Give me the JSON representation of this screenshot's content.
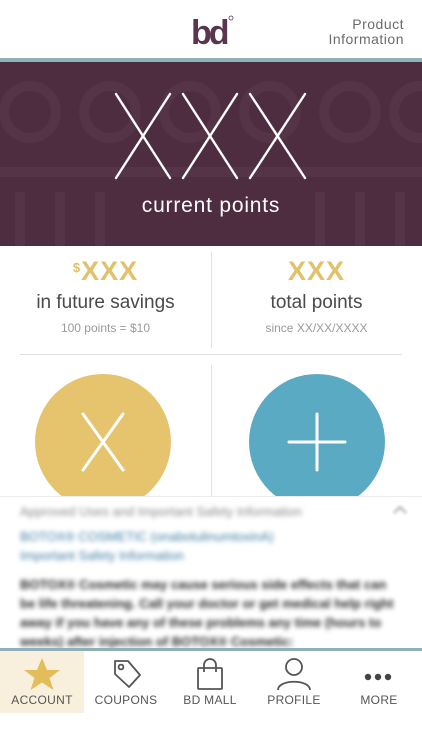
{
  "header": {
    "logo_text": "bd",
    "product_info_line1": "Product",
    "product_info_line2": "Information"
  },
  "hero": {
    "points_value": "XXX",
    "caption": "current points"
  },
  "stats": {
    "savings": {
      "currency": "$",
      "value": "XXX",
      "label": "in future savings",
      "sub": "100 points = $10"
    },
    "total": {
      "value": "XXX",
      "label": "total points",
      "sub": "since XX/XX/XXXX"
    }
  },
  "actions": {
    "remove": {
      "icon": "x-icon",
      "color": "#e6c46e"
    },
    "add": {
      "icon": "plus-icon",
      "color": "#5aaac4"
    }
  },
  "safety": {
    "heading": "Approved Uses and Important Safety Information",
    "link_line1": "BOTOX® COSMETIC (onabotulinumtoxinA)",
    "link_line2": "Important Safety Information",
    "body": "BOTOX® Cosmetic may cause serious side effects that can be life threatening. Call your doctor or get medical help right away if you have any of these problems any time (hours to weeks) after injection of BOTOX® Cosmetic:"
  },
  "tabs": [
    {
      "label": "ACCOUNT",
      "icon": "star-icon",
      "active": true
    },
    {
      "label": "COUPONS",
      "icon": "tag-icon",
      "active": false
    },
    {
      "label": "BD MALL",
      "icon": "shopping-bag-icon",
      "active": false
    },
    {
      "label": "PROFILE",
      "icon": "user-icon",
      "active": false
    },
    {
      "label": "MORE",
      "icon": "more-dots-icon",
      "active": false
    }
  ],
  "colors": {
    "brand_plum": "#4d2d3f",
    "gold": "#e6c46e",
    "blue": "#5aaac4",
    "accent_rule": "#8fb0b8"
  }
}
